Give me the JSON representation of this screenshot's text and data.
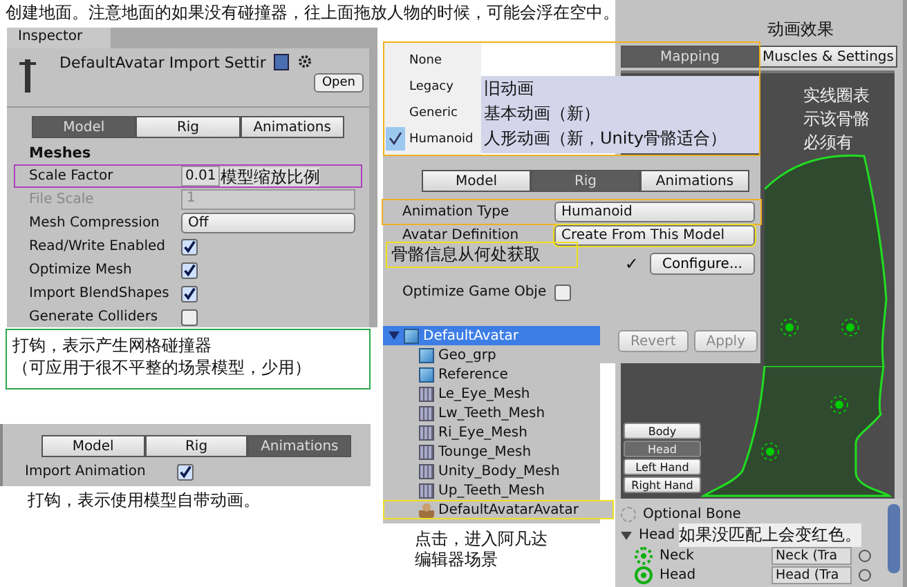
{
  "top_caption": "创建地面。注意地面的如果没有碰撞器，往上面拖放人物的时候，可能会浮在空中。",
  "model_panel": {
    "window_tab": "Inspector",
    "title": "DefaultAvatar Import Settir",
    "open_button": "Open",
    "tabs": [
      {
        "label": "Model",
        "selected": true
      },
      {
        "label": "Rig",
        "selected": false
      },
      {
        "label": "Animations",
        "selected": false
      }
    ],
    "section": "Meshes",
    "scale_factor": {
      "label": "Scale Factor",
      "value": "0.01",
      "note": "模型缩放比例"
    },
    "file_scale": {
      "label": "File Scale",
      "value": "1",
      "disabled": true
    },
    "mesh_compression": {
      "label": "Mesh Compression",
      "value": "Off"
    },
    "checks": [
      {
        "label": "Read/Write Enabled",
        "checked": true
      },
      {
        "label": "Optimize Mesh",
        "checked": true
      },
      {
        "label": "Import BlendShapes",
        "checked": true
      },
      {
        "label": "Generate Colliders",
        "checked": false
      }
    ],
    "note_lines": [
      "打钩，表示产生网格碰撞器",
      "（可应用于很不平整的场景模型，少用）"
    ]
  },
  "animations_panel": {
    "tabs": [
      {
        "label": "Model",
        "selected": false
      },
      {
        "label": "Rig",
        "selected": false
      },
      {
        "label": "Animations",
        "selected": true
      }
    ],
    "import_animation": {
      "label": "Import Animation",
      "checked": true
    },
    "note": "打钩，表示使用模型自带动画。"
  },
  "rig_panel": {
    "menu": [
      {
        "label": "None",
        "selected": false
      },
      {
        "label": "Legacy",
        "selected": false
      },
      {
        "label": "Generic",
        "selected": false
      },
      {
        "label": "Humanoid",
        "selected": true
      }
    ],
    "menu_notes": [
      "旧动画",
      "基本动画（新）",
      "人形动画（新，Unity骨骼适合）"
    ],
    "tabs": [
      {
        "label": "Model",
        "selected": false
      },
      {
        "label": "Rig",
        "selected": true
      },
      {
        "label": "Animations",
        "selected": false
      }
    ],
    "animation_type": {
      "label": "Animation Type",
      "value": "Humanoid"
    },
    "avatar_definition": {
      "label": "Avatar Definition",
      "value": "Create From This Model"
    },
    "avatar_note": "骨骼信息从何处获取",
    "configure_mark": "✓",
    "configure_button": "Configure...",
    "optimize": {
      "label": "Optimize Game Obje",
      "checked": false
    },
    "buttons": [
      {
        "label": "Revert",
        "disabled": true
      },
      {
        "label": "Apply",
        "disabled": true
      }
    ],
    "tree": [
      {
        "label": "DefaultAvatar",
        "kind": "model",
        "selected": true,
        "expanded": true,
        "children": [
          {
            "label": "Geo_grp",
            "kind": "model",
            "selected": false
          },
          {
            "label": "Reference",
            "kind": "model",
            "selected": false
          },
          {
            "label": "Le_Eye_Mesh",
            "kind": "mesh",
            "selected": false
          },
          {
            "label": "Lw_Teeth_Mesh",
            "kind": "mesh",
            "selected": false
          },
          {
            "label": "Ri_Eye_Mesh",
            "kind": "mesh",
            "selected": false
          },
          {
            "label": "Tounge_Mesh",
            "kind": "mesh",
            "selected": false
          },
          {
            "label": "Unity_Body_Mesh",
            "kind": "mesh",
            "selected": false
          },
          {
            "label": "Up_Teeth_Mesh",
            "kind": "mesh",
            "selected": false
          },
          {
            "label": "DefaultAvatarAvatar",
            "kind": "avatar",
            "selected": false
          }
        ]
      }
    ],
    "note_lines": [
      "点击，进入阿凡达",
      "编辑器场景"
    ]
  },
  "avatar_panel": {
    "title": "动画效果",
    "tabs": [
      {
        "label": "Mapping",
        "selected": true
      },
      {
        "label": "Muscles & Settings",
        "selected": false
      }
    ],
    "note_lines": [
      "实线圈表",
      "示该骨骼",
      "必须有"
    ],
    "body_parts": [
      {
        "label": "Body",
        "selected": false
      },
      {
        "label": "Head",
        "selected": true
      },
      {
        "label": "Left Hand",
        "selected": false
      },
      {
        "label": "Right Hand",
        "selected": false
      }
    ],
    "legend": "Optional Bone",
    "group": {
      "label": "Head",
      "expanded": true,
      "note": "如果没匹配上会变红色。"
    },
    "bones": [
      {
        "label": "Neck",
        "required": false,
        "target": "Neck (Tra"
      },
      {
        "label": "Head",
        "required": true,
        "target": "Head (Tra"
      }
    ]
  }
}
